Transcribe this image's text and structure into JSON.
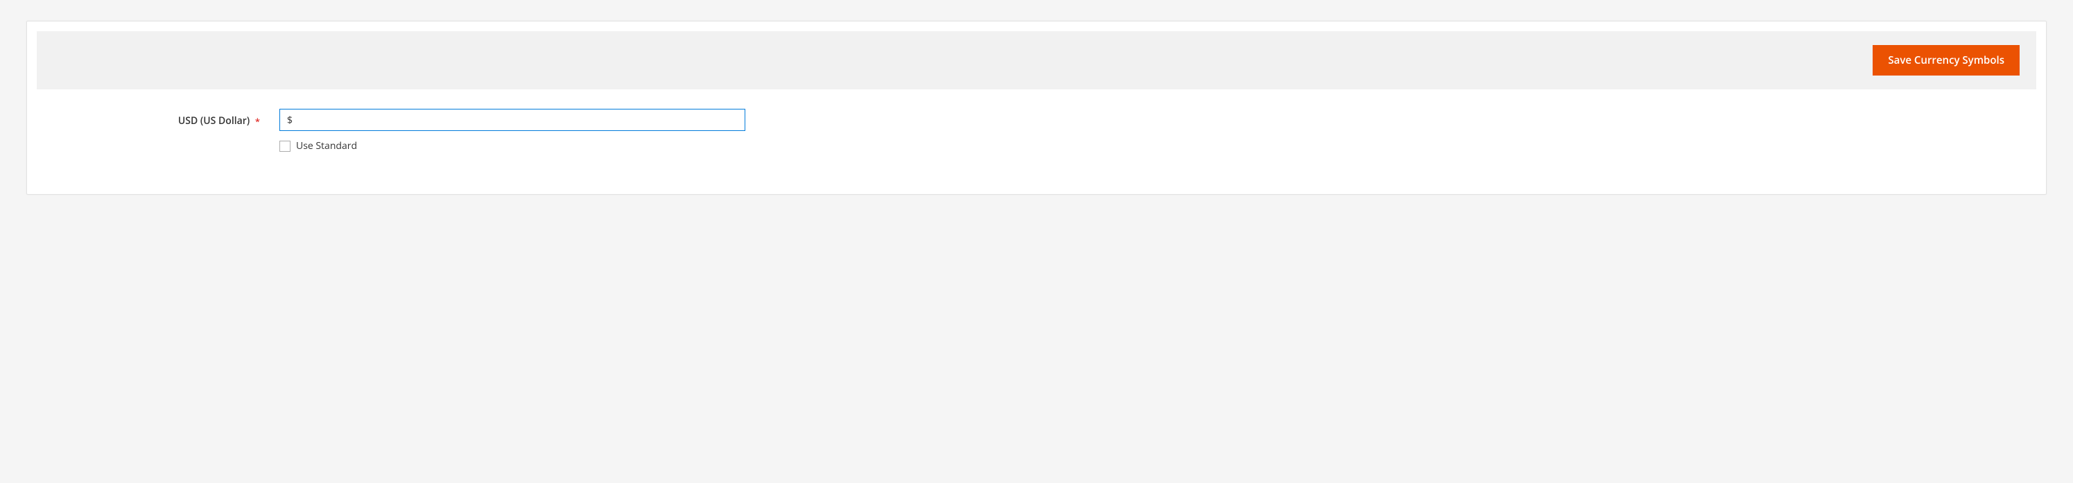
{
  "toolbar": {
    "save_button_label": "Save Currency Symbols"
  },
  "form": {
    "currency": {
      "label": "USD (US Dollar)",
      "required_mark": "*",
      "value": "$",
      "use_standard_label": "Use Standard",
      "use_standard_checked": false
    }
  }
}
